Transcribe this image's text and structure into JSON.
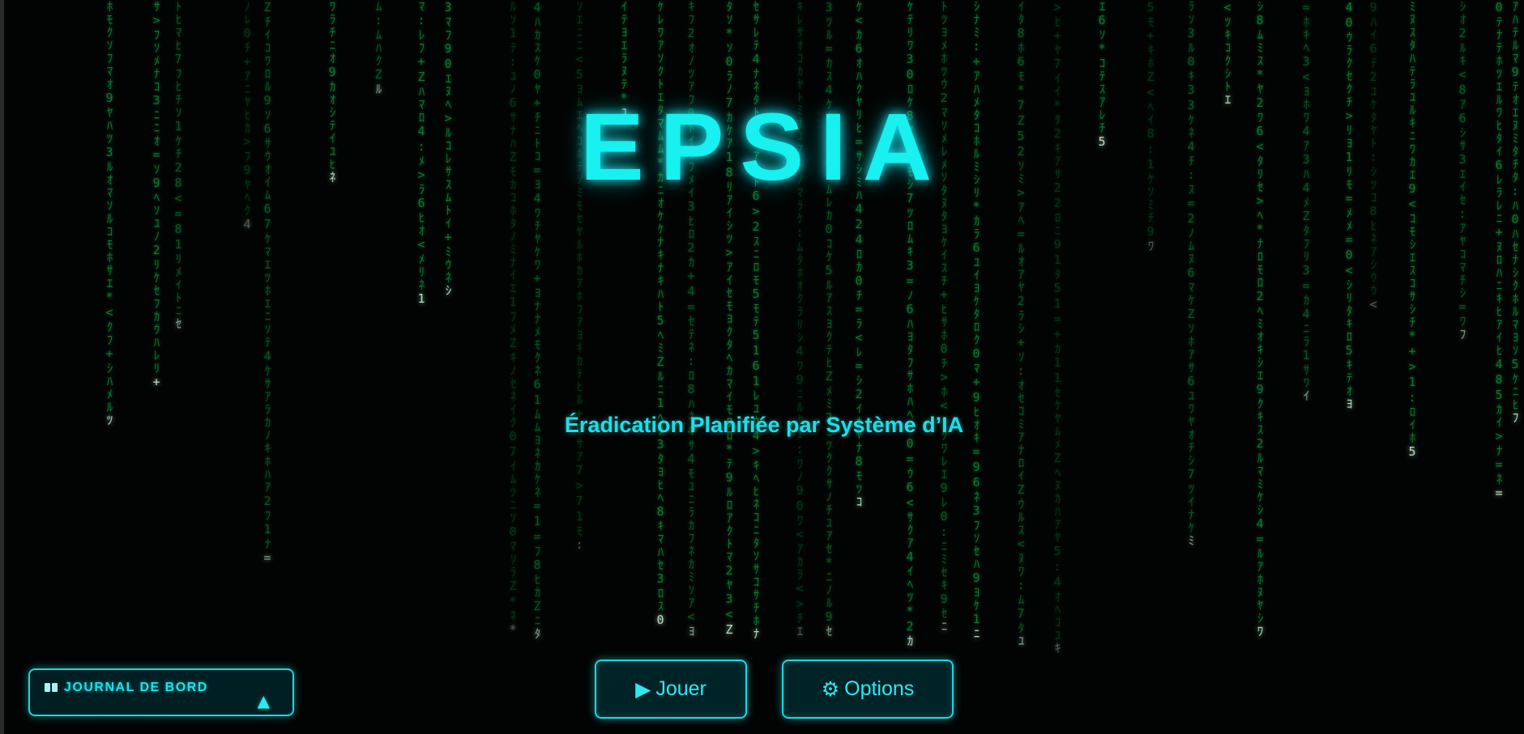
{
  "game": {
    "title": "EPSIA",
    "subtitle": "Éradication Planifiée par Système d’IA"
  },
  "menu": {
    "play_icon": "▶",
    "play_label": "Jouer",
    "options_icon": "⚙",
    "options_label": "Options"
  },
  "journal": {
    "label": "JOURNAL DE BORD",
    "icon": "book-icon",
    "toggle_icon": "▲"
  },
  "colors": {
    "accent": "#19f0f0",
    "rain": "#0f8a3e",
    "background": "#020403"
  }
}
